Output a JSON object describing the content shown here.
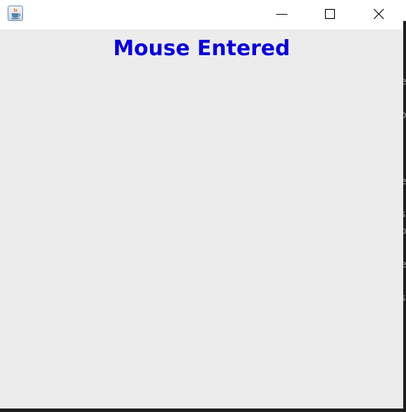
{
  "window": {
    "app_icon": "java-cup-icon",
    "controls": [
      "minimize-icon",
      "maximize-icon",
      "close-icon"
    ]
  },
  "content": {
    "status_text": "Mouse Entered",
    "status_color": "#0a00d6"
  },
  "background": {
    "edge_glyphs": [
      "e",
      "o",
      "e",
      "s",
      "o",
      "e",
      "s"
    ]
  }
}
